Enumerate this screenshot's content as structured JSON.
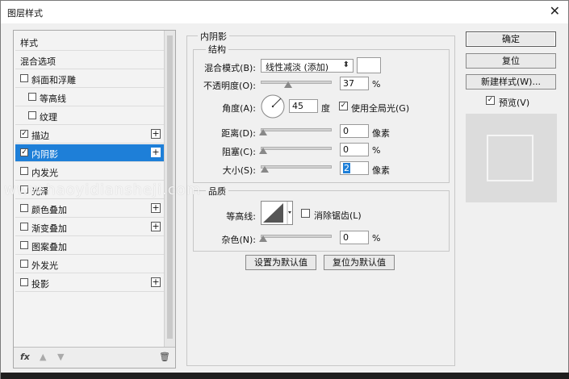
{
  "window": {
    "title": "图层样式",
    "close_glyph": "✕"
  },
  "sidebar": {
    "items": [
      {
        "label": "样式"
      },
      {
        "label": "混合选项"
      },
      {
        "label": "斜面和浮雕",
        "checked": false
      },
      {
        "label": "等高线",
        "checked": false
      },
      {
        "label": "纹理",
        "checked": false
      },
      {
        "label": "描边",
        "checked": true
      },
      {
        "label": "内阴影",
        "checked": true,
        "selected": true
      },
      {
        "label": "内发光",
        "checked": false
      },
      {
        "label": "光泽",
        "checked": false
      },
      {
        "label": "颜色叠加",
        "checked": false
      },
      {
        "label": "渐变叠加",
        "checked": false
      },
      {
        "label": "图案叠加",
        "checked": false
      },
      {
        "label": "外发光",
        "checked": false
      },
      {
        "label": "投影",
        "checked": false
      }
    ],
    "footer": {
      "fx_label": "fx",
      "up_icon": "▲",
      "down_icon": "▼",
      "trash_icon": "🗑"
    }
  },
  "panel": {
    "title": "内阴影",
    "structure": {
      "title": "结构",
      "blend_mode_label": "混合模式(B):",
      "blend_mode_value": "线性减淡 (添加)",
      "opacity_label": "不透明度(O):",
      "opacity_value": "37",
      "opacity_unit": "%",
      "angle_label": "角度(A):",
      "angle_value": "45",
      "angle_unit": "度",
      "global_light_label": "使用全局光(G)",
      "global_light_checked": true,
      "distance_label": "距离(D):",
      "distance_value": "0",
      "distance_unit": "像素",
      "choke_label": "阻塞(C):",
      "choke_value": "0",
      "choke_unit": "%",
      "size_label": "大小(S):",
      "size_value": "2",
      "size_unit": "像素"
    },
    "quality": {
      "title": "品质",
      "contour_label": "等高线:",
      "anti_alias_label": "消除锯齿(L)",
      "anti_alias_checked": false,
      "noise_label": "杂色(N):",
      "noise_value": "0",
      "noise_unit": "%"
    },
    "buttons": {
      "make_default": "设置为默认值",
      "reset_default": "复位为默认值"
    }
  },
  "right": {
    "ok": "确定",
    "reset": "复位",
    "new_style": "新建样式(W)...",
    "preview_label": "预览(V)",
    "preview_checked": true
  },
  "watermark": "www.haoyidiansheji.com",
  "slider_levels": {
    "opacity": 0.37,
    "angle_deg": 45,
    "distance": 0,
    "choke": 0,
    "size": 0.02,
    "noise": 0
  }
}
